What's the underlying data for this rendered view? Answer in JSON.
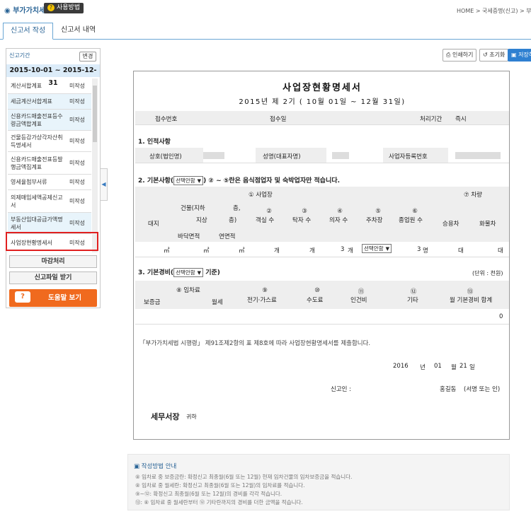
{
  "header": {
    "app_title": "부가가치세",
    "usage_label": "사용방법",
    "breadcrumb": "HOME > 국세증명(신고) > 부가가치"
  },
  "tabs": [
    {
      "label": "신고서 작성",
      "active": true
    },
    {
      "label": "신고서 내역",
      "active": false
    }
  ],
  "sidebar": {
    "period_label": "신고기간",
    "change_label": "변경",
    "period": "2015-10-01 ~ 2015-12-31",
    "items": [
      {
        "name": "계산서합계표",
        "status": "미작성"
      },
      {
        "name": "세금계산서합계표",
        "status": "미작성"
      },
      {
        "name": "신용카드매출전표등수령금액합계표",
        "status": "미작성"
      },
      {
        "name": "건물등감가상각자산취득명세서",
        "status": "미작성"
      },
      {
        "name": "신용카드매출전표등발행금액집계표",
        "status": "미작성"
      },
      {
        "name": "영세율첨부서류",
        "status": "미작성"
      },
      {
        "name": "의제매입세액공제신고서",
        "status": "미작성"
      },
      {
        "name": "부동산임대공급가액명세서",
        "status": "미작성"
      },
      {
        "name": "사업장현황명세서",
        "status": "미작성"
      }
    ],
    "close_btn": "마감처리",
    "receive_btn": "신고파일 받기",
    "help_btn": "도움말 보기",
    "collapse_icon": "◀"
  },
  "toolbar": {
    "print": "인쇄하기",
    "reset": "초기화",
    "save": "저장하기"
  },
  "doc": {
    "title": "사업장현황명세서",
    "subtitle": "2015년 제 2기 ( 10월 01일 ~ 12월 31일)",
    "receipt_no_lbl": "접수번호",
    "receipt_date_lbl": "접수일",
    "proc_period_lbl": "처리기간",
    "proc_period_val": "즉시",
    "sec1": "1. 인적사항",
    "biz_name_lbl": "상호(법인명)",
    "rep_name_lbl": "성명(대표자명)",
    "biz_no_lbl": "사업자등록번호",
    "sec2_prefix": "2. 기본사항(",
    "sec2_select": "선택안함",
    "sec2_suffix": ") ② ~ ⑤란은 음식점업자 및 숙박업자만 적습니다.",
    "h_site": "① 사업장",
    "h_vehicle": "⑦ 차량",
    "h_land": "대지",
    "h_building": "건물(지하",
    "h_floor1": "층,",
    "h_above": "지상",
    "h_floor2": "층)",
    "h_floor_area": "바닥면적",
    "h_total_area": "연면적",
    "h_seats_n": "②",
    "h_seats": "객실 수",
    "h_tables_n": "③",
    "h_tables": "탁자 수",
    "h_chairs_n": "④",
    "h_chairs": "의자 수",
    "h_parking_n": "⑤",
    "h_parking": "주차장",
    "h_staff_n": "⑥",
    "h_staff": "종업원 수",
    "h_car": "승용차",
    "h_truck": "화물차",
    "u_m2": "㎡",
    "u_rooms": "개",
    "u_tables": "개",
    "chairs_val": "3",
    "u_chairs": "개",
    "parking_val": "선택안함",
    "staff_val": "3",
    "u_staff": "명",
    "u_car": "대",
    "u_truck": "대",
    "sec3_prefix": "3. 기본경비(",
    "sec3_select": "선택안함",
    "sec3_suffix": "기준)",
    "unit_note": "(단위 : 천원)",
    "h_rent": "⑧ 임차료",
    "h_deposit": "보증금",
    "h_monthly": "월세",
    "h_elec_n": "⑨",
    "h_elec": "전기·가스료",
    "h_water_n": "⑩",
    "h_water": "수도료",
    "h_labor_n": "⑪",
    "h_labor": "인건비",
    "h_etc_n": "⑫",
    "h_etc": "기타",
    "h_total_n": "⑬",
    "h_total": "월 기본경비 합계",
    "total_val": "0",
    "declaration": "「부가가치세법 시행령」 제91조제2항의 표 제8호에 따라 사업장현황명세서를 제출합니다.",
    "date_y": "2016",
    "date_yl": "년",
    "date_m": "01",
    "date_ml": "월",
    "date_d": "21",
    "date_dl": "일",
    "reporter_lbl": "신고인 :",
    "reporter_name": "홍길동",
    "sign_note": "(서명 또는 인)",
    "office": "세무서장",
    "office_suffix": "귀하"
  },
  "guide": {
    "title": "작성방법 안내",
    "lines": [
      "⑧ 임차료 중 보증금란: 확정신고 최종월(6월 또는 12월) 현재 임차건물의 임차보증금을 적습니다.",
      "⑧ 임차료 중 월세란: 확정신고 최종월(6월 또는 12월)의 임차료를 적습니다.",
      "⑨~⑫: 확정신고 최종월(6월 또는 12월)의 경비를 각각 적습니다.",
      "⑬: ⑧ 임차료 중 월세란부터 ⑫ 기타란까지의 경비를 더한 금액을 적습니다."
    ]
  }
}
